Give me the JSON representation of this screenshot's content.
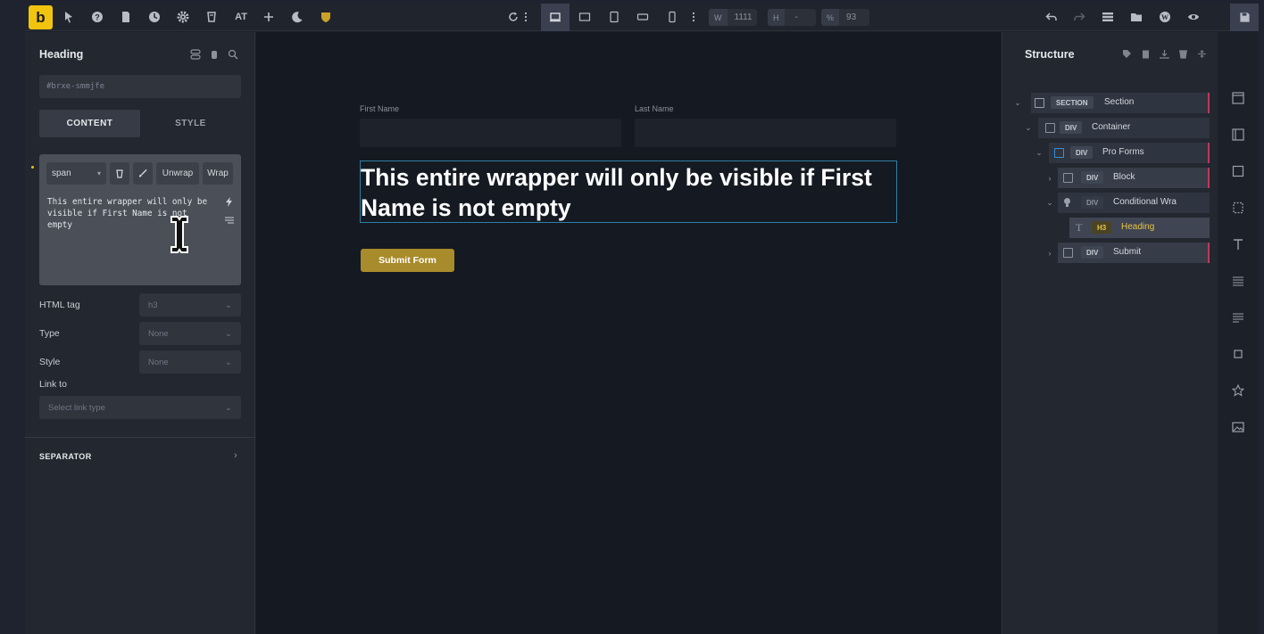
{
  "toolbar": {
    "logo": "b",
    "left_icons": [
      "pointer-icon",
      "help-icon",
      "page-icon",
      "history-icon",
      "settings-icon",
      "template-icon"
    ],
    "at_label": "AT",
    "width_label": "W",
    "width_value": "1111",
    "height_label": "H",
    "height_value": "-",
    "zoom_label": "%",
    "zoom_value": "93"
  },
  "left_panel": {
    "title": "Heading",
    "element_id": "#brxe-smmjfe",
    "tabs": [
      {
        "label": "CONTENT",
        "active": true
      },
      {
        "label": "STYLE",
        "active": false
      }
    ],
    "editor": {
      "tag_select": "span",
      "unwrap_label": "Unwrap",
      "wrap_label": "Wrap",
      "text_line1": "This entire wrapper will only be",
      "text_line2": "visible if First Name is not",
      "text_line3": "empty"
    },
    "fields": {
      "html_tag_label": "HTML tag",
      "html_tag_value": "h3",
      "type_label": "Type",
      "type_value": "None",
      "style_label": "Style",
      "style_value": "None",
      "link_label": "Link to",
      "link_placeholder": "Select link type"
    },
    "separator_label": "SEPARATOR"
  },
  "canvas": {
    "first_name_label": "First Name",
    "last_name_label": "Last Name",
    "heading_line1": "This entire wrapper will only be visible if First",
    "heading_line2": "Name is not empty",
    "submit_label": "Submit Form",
    "accent": "#a88b2a"
  },
  "structure": {
    "title": "Structure",
    "nodes": [
      {
        "tag": "SECTION",
        "name": "Section"
      },
      {
        "tag": "DIV",
        "name": "Container"
      },
      {
        "tag": "DIV",
        "name": "Pro Forms"
      },
      {
        "tag": "DIV",
        "name": "Block"
      },
      {
        "tag": "DIV",
        "name": "Conditional Wra"
      },
      {
        "tag": "H3",
        "name": "Heading"
      },
      {
        "tag": "DIV",
        "name": "Submit"
      }
    ]
  }
}
